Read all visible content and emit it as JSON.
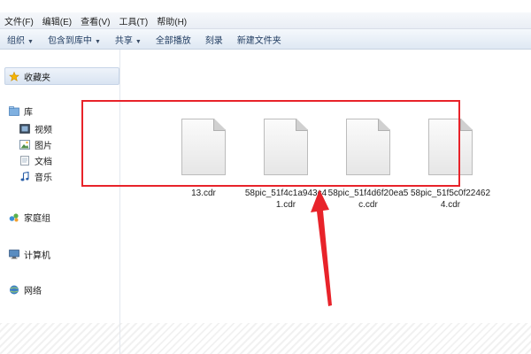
{
  "menu": [
    "文件(F)",
    "编辑(E)",
    "查看(V)",
    "工具(T)",
    "帮助(H)"
  ],
  "toolbar": [
    {
      "label": "组织",
      "dropdown": true
    },
    {
      "label": "包含到库中",
      "dropdown": true
    },
    {
      "label": "共享",
      "dropdown": true
    },
    {
      "label": "全部播放",
      "dropdown": false
    },
    {
      "label": "刻录",
      "dropdown": false
    },
    {
      "label": "新建文件夹",
      "dropdown": false
    }
  ],
  "sidebar": {
    "favorites": "收藏夹",
    "library": "库",
    "library_items": [
      "视频",
      "图片",
      "文档",
      "音乐"
    ],
    "homegroup": "家庭组",
    "computer": "计算机",
    "network": "网络"
  },
  "files": [
    "13.cdr",
    "58pic_51f4c1a943c41.cdr",
    "58pic_51f4d6f20ea5c.cdr",
    "58pic_51f5c0f224624.cdr"
  ],
  "colors": {
    "highlight": "#e8232a",
    "toolbar_text": "#1e3a5f"
  },
  "icons": [
    "star-icon",
    "library-icon",
    "video-icon",
    "picture-icon",
    "document-icon",
    "music-icon",
    "homegroup-icon",
    "computer-icon",
    "network-icon",
    "cdr-file-icon"
  ]
}
